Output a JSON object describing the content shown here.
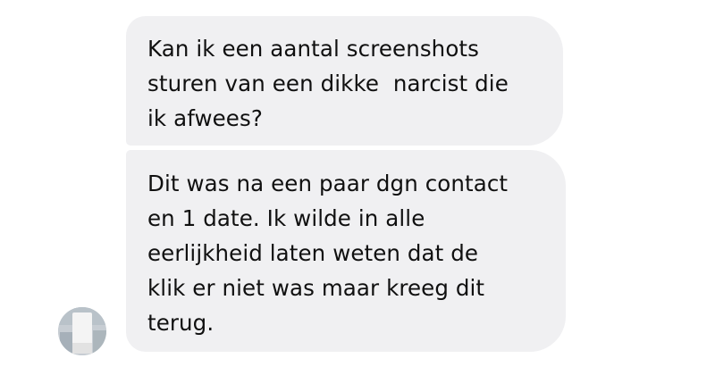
{
  "messages": [
    {
      "text": "Kan ik een aantal screenshots\nsturen van een dikke  narcist die\nik afwees?"
    },
    {
      "text": "Dit was na een paar dgn contact\nen 1 date. Ik wilde in alle\neerlijkheid laten weten dat de\nklik er niet was maar kreeg dit\nterug."
    }
  ],
  "avatar": {
    "icon": "contact-avatar",
    "colors": {
      "background": "#c7cdd3",
      "figure": "#f4f4f4",
      "shade": "#8a99a4"
    }
  },
  "colors": {
    "bubble": "#f0f0f2",
    "text": "#101010",
    "page": "#ffffff"
  }
}
